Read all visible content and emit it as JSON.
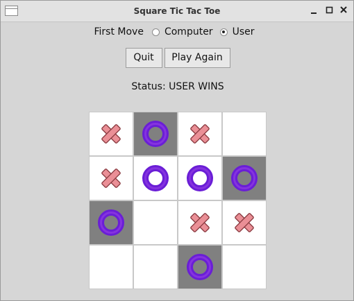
{
  "window": {
    "title": "Square Tic Tac Toe"
  },
  "first_move": {
    "label": "First Move",
    "options": [
      {
        "label": "Computer",
        "selected": false
      },
      {
        "label": "User",
        "selected": true
      }
    ]
  },
  "buttons": {
    "quit_label": "Quit",
    "play_again_label": "Play Again"
  },
  "status": {
    "label": "Status:",
    "value": "USER WINS"
  },
  "board": {
    "rows": [
      [
        {
          "mark": "X",
          "highlight": false
        },
        {
          "mark": "O",
          "highlight": true
        },
        {
          "mark": "X",
          "highlight": false
        },
        {
          "mark": "",
          "highlight": false
        }
      ],
      [
        {
          "mark": "X",
          "highlight": false
        },
        {
          "mark": "O",
          "highlight": false
        },
        {
          "mark": "O",
          "highlight": false
        },
        {
          "mark": "O",
          "highlight": true
        }
      ],
      [
        {
          "mark": "O",
          "highlight": true
        },
        {
          "mark": "",
          "highlight": false
        },
        {
          "mark": "X",
          "highlight": false
        },
        {
          "mark": "X",
          "highlight": false
        }
      ],
      [
        {
          "mark": "",
          "highlight": false
        },
        {
          "mark": "",
          "highlight": false
        },
        {
          "mark": "O",
          "highlight": true
        },
        {
          "mark": "",
          "highlight": false
        }
      ]
    ]
  },
  "colors": {
    "x_fill": "#ea8f96",
    "x_stroke": "#8a3a40",
    "o_ring": "#6a1ed6",
    "highlight_bg": "#808080"
  }
}
